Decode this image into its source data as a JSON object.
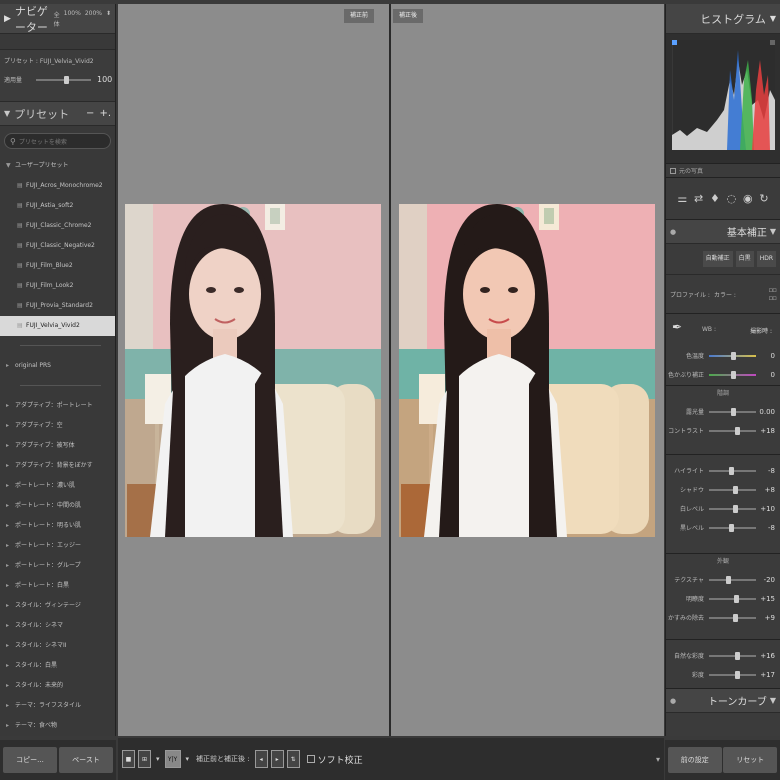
{
  "navigator": {
    "title": "ナビゲーター",
    "zoom_fit": "全体",
    "zoom_100": "100%",
    "zoom_200": "200%"
  },
  "preset_info": {
    "label": "プリセット : FUJI_Velvia_Vivid2",
    "amount_label": "適用量",
    "amount_value": "100"
  },
  "presets": {
    "title": "プリセット",
    "minus": "−",
    "plus": "+.",
    "search_placeholder": "プリセットを検索",
    "user_group": "ユーザープリセット",
    "user_items": [
      "FUJI_Acros_Monochrome2",
      "FUJI_Astia_soft2",
      "FUJI_Classic_Chrome2",
      "FUJI_Classic_Negative2",
      "FUJI_Film_Blue2",
      "FUJI_Film_Look2",
      "FUJI_Provia_Standard2",
      "FUJI_Velvia_Vivid2"
    ],
    "selected_index": 7,
    "original_group": "original PRS",
    "groups": [
      "アダプティブ：ポートレート",
      "アダプティブ：空",
      "アダプティブ：被写体",
      "アダプティブ：背景をぼかす",
      "ポートレート：濃い肌",
      "ポートレート：中間の肌",
      "ポートレート：明るい肌",
      "ポートレート：エッジー",
      "ポートレート：グループ",
      "ポートレート：白黒",
      "スタイル：ヴィンテージ",
      "スタイル：シネマ",
      "スタイル：シネマII",
      "スタイル：白黒",
      "スタイル：未来的",
      "テーマ：ライフスタイル",
      "テーマ：食べ物"
    ]
  },
  "left_buttons": {
    "copy": "コピー...",
    "paste": "ペースト"
  },
  "center": {
    "before_tag": "補正前",
    "after_tag": "補正後"
  },
  "toolbar": {
    "view_yy": "Y|Y",
    "before_after_label": "補正前と補正後 :",
    "soft_proof": "ソフト校正"
  },
  "histogram": {
    "title": "ヒストグラム",
    "original_photo": "元の写真"
  },
  "basic": {
    "title": "基本補正",
    "chips": [
      "自動補正",
      "白黒",
      "HDR"
    ],
    "profile_label": "プロファイル :",
    "profile_value": "カラー :",
    "wb_label": "WB :",
    "wb_value": "撮影時 :",
    "temp_label": "色温度",
    "temp_value": "0",
    "tint_label": "色かぶり補正",
    "tint_value": "0",
    "tone_title": "階調",
    "tone": [
      {
        "label": "露光量",
        "value": "0.00",
        "pos": 0.5
      },
      {
        "label": "コントラスト",
        "value": "+18",
        "pos": 0.59
      }
    ],
    "tone2": [
      {
        "label": "ハイライト",
        "value": "-8",
        "pos": 0.46
      },
      {
        "label": "シャドウ",
        "value": "+8",
        "pos": 0.54
      },
      {
        "label": "白レベル",
        "value": "+10",
        "pos": 0.55
      },
      {
        "label": "黒レベル",
        "value": "-8",
        "pos": 0.46
      }
    ],
    "presence_title": "外観",
    "presence": [
      {
        "label": "テクスチャ",
        "value": "-20",
        "pos": 0.4
      },
      {
        "label": "明瞭度",
        "value": "+15",
        "pos": 0.57
      },
      {
        "label": "かすみの除去",
        "value": "+9",
        "pos": 0.54
      }
    ],
    "presence2": [
      {
        "label": "自然な彩度",
        "value": "+16",
        "pos": 0.58
      },
      {
        "label": "彩度",
        "value": "+17",
        "pos": 0.58
      }
    ]
  },
  "tone_curve": {
    "title": "トーンカーブ"
  },
  "right_buttons": {
    "previous": "前の設定",
    "reset": "リセット"
  }
}
